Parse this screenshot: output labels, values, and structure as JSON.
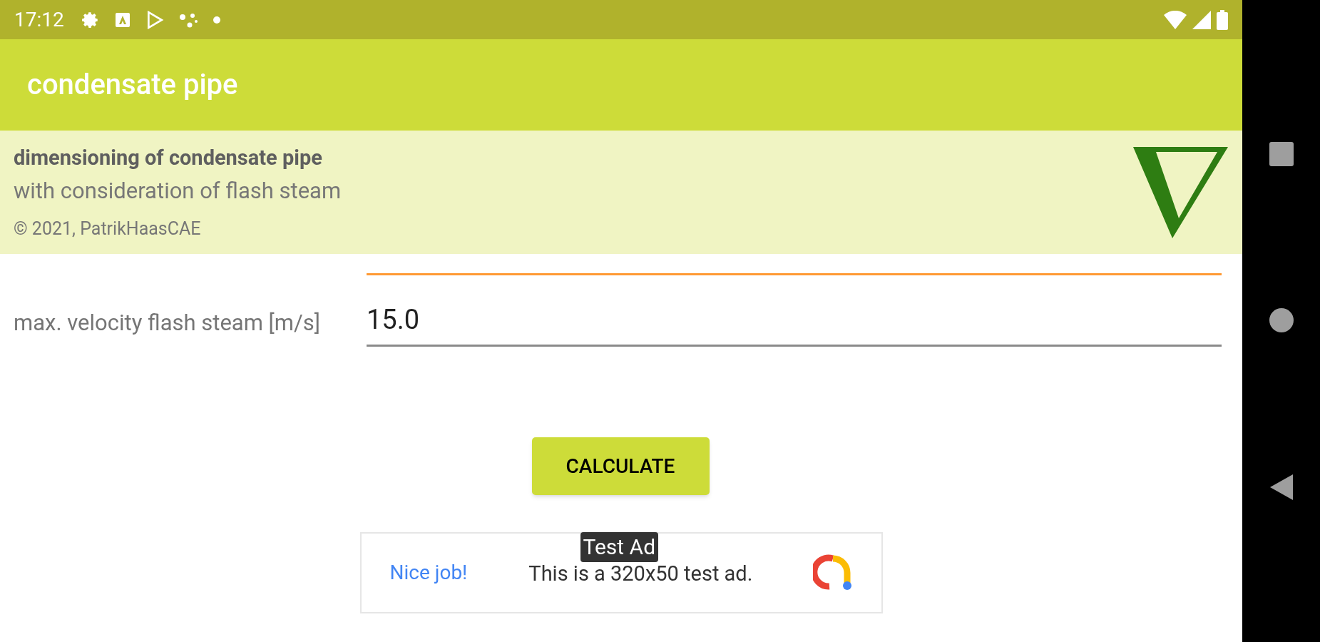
{
  "status_bar": {
    "time": "17:12"
  },
  "app_bar": {
    "title": "condensate pipe"
  },
  "info_panel": {
    "heading": "dimensioning of condensate pipe",
    "subtitle": "with consideration of flash steam",
    "copyright": "© 2021, PatrikHaasCAE"
  },
  "fields": [
    {
      "focused": true
    },
    {
      "label": "max. velocity flash steam [m/s]",
      "value": "15.0",
      "focused": false
    }
  ],
  "button": {
    "label": "CALCULATE"
  },
  "ad": {
    "badge": "Test Ad",
    "link": "Nice job!",
    "text": "This is a 320x50 test ad."
  }
}
